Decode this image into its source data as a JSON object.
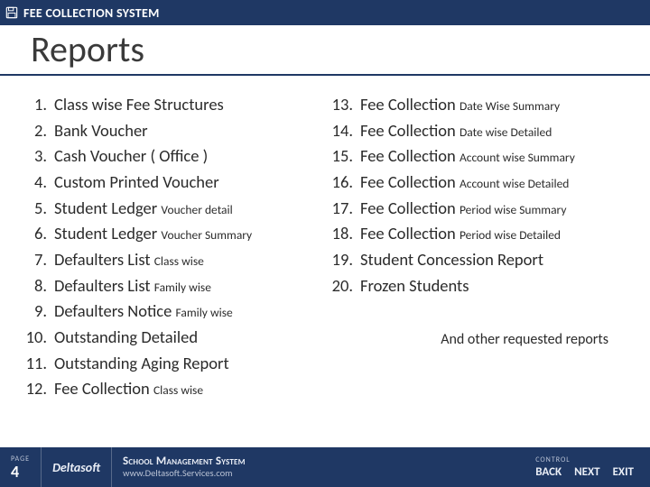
{
  "topbar": {
    "icon": "save-disk-icon",
    "title": "FEE COLLECTION SYSTEM"
  },
  "title": "Reports",
  "left_items": [
    {
      "n": "1.",
      "main": "Class wise Fee Structures",
      "sub": ""
    },
    {
      "n": "2.",
      "main": "Bank Voucher",
      "sub": ""
    },
    {
      "n": "3.",
      "main": "Cash Voucher ( Office )",
      "sub": ""
    },
    {
      "n": "4.",
      "main": "Custom Printed Voucher",
      "sub": ""
    },
    {
      "n": "5.",
      "main": "Student Ledger ",
      "sub": "Voucher detail"
    },
    {
      "n": "6.",
      "main": "Student Ledger ",
      "sub": "Voucher Summary"
    },
    {
      "n": "7.",
      "main": "Defaulters List ",
      "sub": "Class wise"
    },
    {
      "n": "8.",
      "main": "Defaulters List ",
      "sub": "Family wise"
    },
    {
      "n": "9.",
      "main": "Defaulters Notice ",
      "sub": "Family wise"
    },
    {
      "n": "10.",
      "main": "Outstanding Detailed",
      "sub": ""
    },
    {
      "n": "11.",
      "main": "Outstanding Aging Report",
      "sub": ""
    },
    {
      "n": "12.",
      "main": "Fee Collection ",
      "sub": "Class wise"
    }
  ],
  "right_items": [
    {
      "n": "13.",
      "main": "Fee Collection ",
      "sub": "Date Wise Summary"
    },
    {
      "n": "14.",
      "main": "Fee Collection ",
      "sub": "Date wise Detailed"
    },
    {
      "n": "15.",
      "main": "Fee Collection ",
      "sub": "Account wise Summary"
    },
    {
      "n": "16.",
      "main": "Fee Collection ",
      "sub": "Account wise Detailed"
    },
    {
      "n": "17.",
      "main": "Fee Collection ",
      "sub": "Period wise Summary"
    },
    {
      "n": "18.",
      "main": "Fee Collection ",
      "sub": "Period wise Detailed"
    },
    {
      "n": "19.",
      "main": "Student Concession Report",
      "sub": ""
    },
    {
      "n": "20.",
      "main": "Frozen Students",
      "sub": ""
    }
  ],
  "note": "And other requested reports",
  "footer": {
    "page_label": "PAGE",
    "page_num": "4",
    "brand": "Deltasoft",
    "sys_title": "School Management System",
    "sys_url": "www.Deltasoft.Services.com",
    "control_label": "CONTROL",
    "nav": {
      "back": "BACK",
      "next": "NEXT",
      "exit": "EXIT"
    }
  }
}
